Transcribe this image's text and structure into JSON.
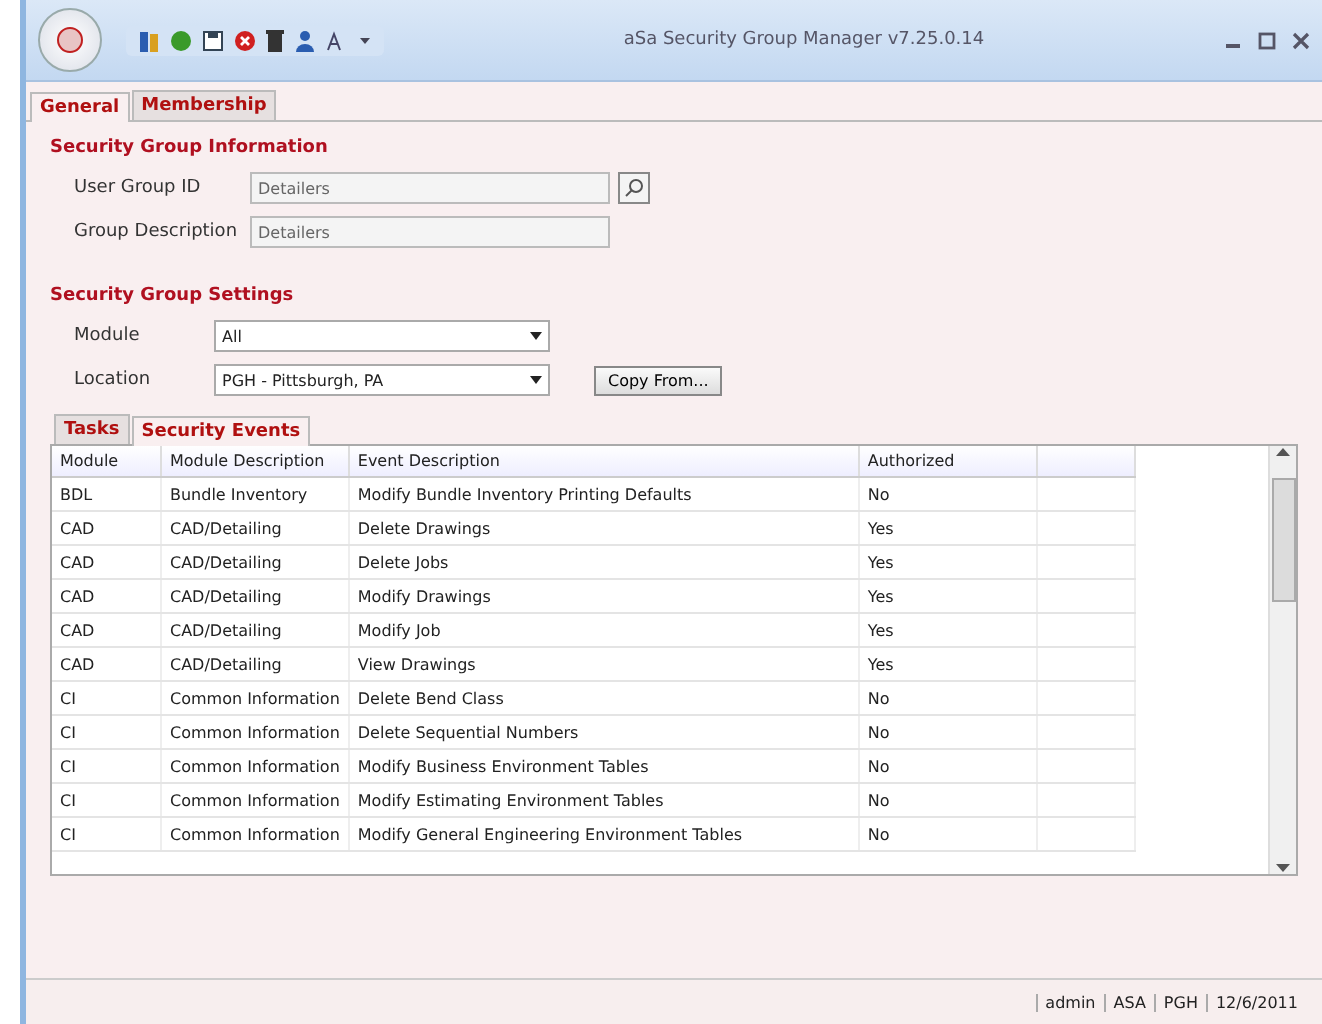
{
  "window": {
    "title": "aSa Security Group Manager v7.25.0.14"
  },
  "tabs": [
    {
      "label": "General",
      "selected": true
    },
    {
      "label": "Membership",
      "selected": false
    }
  ],
  "info": {
    "heading": "Security Group Information",
    "user_group_id": {
      "label": "User Group ID",
      "value": "Detailers"
    },
    "group_description": {
      "label": "Group Description",
      "value": "Detailers"
    }
  },
  "settings": {
    "heading": "Security Group Settings",
    "module": {
      "label": "Module",
      "value": "All"
    },
    "location": {
      "label": "Location",
      "value": "PGH - Pittsburgh, PA"
    },
    "copy_button": "Copy From..."
  },
  "subtabs": [
    {
      "label": "Tasks",
      "selected": false
    },
    {
      "label": "Security Events",
      "selected": true
    }
  ],
  "table": {
    "columns": [
      "Module",
      "Module Description",
      "Event Description",
      "Authorized"
    ],
    "rows": [
      [
        "BDL",
        "Bundle Inventory",
        "Modify Bundle Inventory Printing Defaults",
        "No"
      ],
      [
        "CAD",
        "CAD/Detailing",
        "Delete Drawings",
        "Yes"
      ],
      [
        "CAD",
        "CAD/Detailing",
        "Delete Jobs",
        "Yes"
      ],
      [
        "CAD",
        "CAD/Detailing",
        "Modify Drawings",
        "Yes"
      ],
      [
        "CAD",
        "CAD/Detailing",
        "Modify Job",
        "Yes"
      ],
      [
        "CAD",
        "CAD/Detailing",
        "View Drawings",
        "Yes"
      ],
      [
        "CI",
        "Common Information",
        "Delete Bend Class",
        "No"
      ],
      [
        "CI",
        "Common Information",
        "Delete Sequential Numbers",
        "No"
      ],
      [
        "CI",
        "Common Information",
        "Modify Business Environment Tables",
        "No"
      ],
      [
        "CI",
        "Common Information",
        "Modify Estimating Environment Tables",
        "No"
      ],
      [
        "CI",
        "Common Information",
        "Modify General Engineering Environment Tables",
        "No"
      ]
    ]
  },
  "status_bar": [
    "admin",
    "ASA",
    "PGH",
    "12/6/2011"
  ]
}
